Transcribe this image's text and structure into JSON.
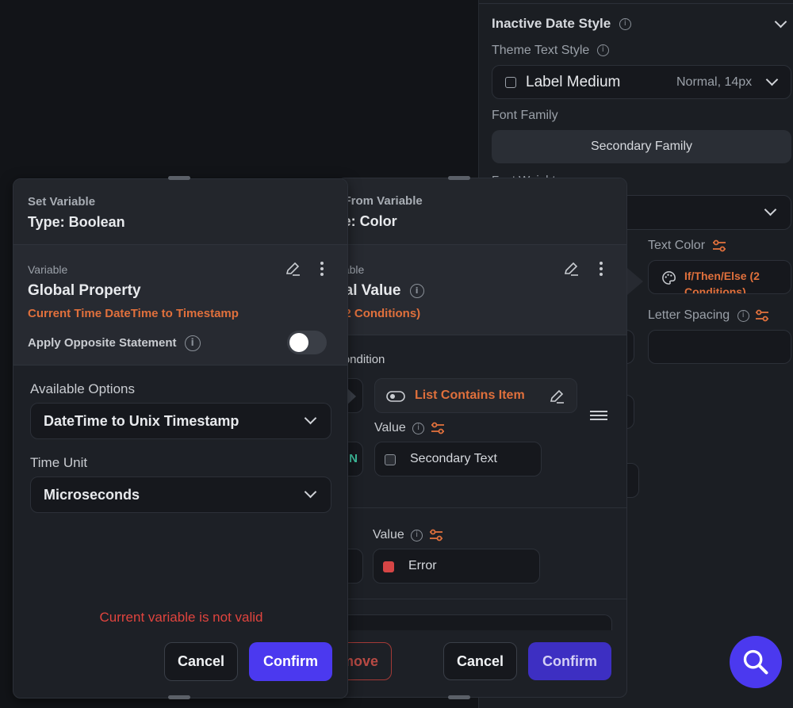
{
  "right_panel": {
    "inactive_date_style": "Inactive Date Style",
    "theme_text_style_label": "Theme Text Style",
    "theme_text_style_value": "Label Medium",
    "theme_text_style_meta": "Normal, 14px",
    "font_family_label": "Font Family",
    "font_family_value": "Secondary Family",
    "font_weight_label": "Font Weight",
    "text_color_label": "Text Color",
    "text_color_value": "If/Then/Else (2 Conditions)",
    "letter_spacing_label": "Letter Spacing"
  },
  "back_dialog": {
    "header_small": "Set From Variable",
    "header_type": "Type: Color",
    "variable_label": "Variable",
    "variable_title": "Conditional Value",
    "variable_sub": "If/Then/Else (2 Conditions)",
    "condition_label": "Condition",
    "condition_value": "List Contains Item",
    "value_label": "Value",
    "value1": "Secondary Text",
    "value2": "Error",
    "remove_label": "Remove",
    "cancel_label": "Cancel",
    "confirm_label": "Confirm"
  },
  "front_dialog": {
    "header_small": "Set Variable",
    "header_type": "Type: Boolean",
    "variable_label": "Variable",
    "variable_title": "Global Property",
    "variable_sub": "Current Time DateTime to Timestamp",
    "apply_opposite_label": "Apply Opposite Statement",
    "available_options_label": "Available Options",
    "available_options_value": "DateTime to Unix Timestamp",
    "time_unit_label": "Time Unit",
    "time_unit_value": "Microseconds",
    "error_text": "Current variable is not valid",
    "cancel_label": "Cancel",
    "confirm_label": "Confirm"
  },
  "colors": {
    "accent": "#4b39ef",
    "orange": "#e0703c",
    "error": "#e0443e",
    "secondary_text_swatch": "#2a2d33",
    "error_swatch": "#d64545"
  },
  "icons": [
    "info-icon",
    "chevron-down-icon",
    "edit-icon",
    "more-vertical-icon",
    "tune-icon",
    "palette-icon",
    "toggle-icon",
    "drag-handle-icon",
    "search-icon"
  ]
}
